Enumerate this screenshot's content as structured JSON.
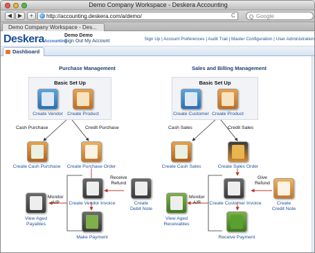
{
  "browser": {
    "window_title": "Demo Company Workspace - Deskera Accounting",
    "url": "http://accounting.deskera.com/a/demo/",
    "search_placeholder": "Google",
    "tab_label": "Demo Company Workspace - Des...",
    "back_label": "◀",
    "forward_label": "▶",
    "add_label": "+",
    "reload_label": "C"
  },
  "app": {
    "logo_main": "Deskera",
    "logo_sub": "Accounting",
    "user_name": "Demo Demo",
    "user_links": "Sign Out  My Account",
    "header_links": "Sign Up | Account Preferences | Audit Trail | Master Configuration | User Administration",
    "page_tab": "Dashboard"
  },
  "purchase": {
    "title": "Purchase Management",
    "setup_title": "Basic Set Up",
    "create_vendor": "Create Vendor",
    "create_product": "Create Product",
    "cash_purchase": "Cash Purchase",
    "credit_purchase": "Credit Purchase",
    "create_cash_purchase": "Create Cash Purchase",
    "create_purchase_order": "Create Purchase Order",
    "receive_refund": "Receive\nRefund",
    "monitor_ap": "Monitor\nA/P",
    "create_vendor_invoice": "Create Vendor Invoice",
    "create_debit_note": "Create\nDebit Note",
    "view_aged_payables": "View Aged\nPayables",
    "make_payment": "Make Payment"
  },
  "sales": {
    "title": "Sales and Billing Management",
    "setup_title": "Basic Set Up",
    "create_customer": "Create Customer",
    "create_product": "Create Product",
    "cash_sales": "Cash Sales",
    "credit_sales": "Credit Sales",
    "create_cash_sales": "Create Cash Sales",
    "create_sales_order": "Create Sales Order",
    "give_refund": "Give\nRefund",
    "monitor_ar": "Monitor\nA/R",
    "create_customer_invoice": "Create Customer Invoice",
    "create_credit_note": "Create\nCredit Note",
    "view_aged_receivables": "View Aged\nReceivables",
    "receive_payment": "Receive Payment"
  },
  "colors": {
    "brand_blue": "#1b4f93",
    "link_blue": "#1d4f97",
    "arrow_red": "#c0392b",
    "icon_blue": "#2f7fc4",
    "icon_orange": "#d98a2b",
    "icon_green": "#5a9a2a",
    "icon_dark": "#4a4a4a"
  }
}
